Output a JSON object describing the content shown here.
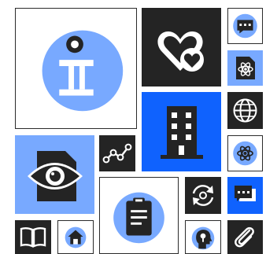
{
  "palette": {
    "dark": "#242424",
    "blue": "#0f62fe",
    "light_blue": "#78a9ff",
    "white": "#ffffff",
    "outline": "#2b2b2b"
  },
  "tiles": [
    {
      "icon": "information-icon",
      "background": "white"
    },
    {
      "icon": "favorite-hearts-icon",
      "background": "dark"
    },
    {
      "icon": "chat-bubble-icon",
      "background": "white"
    },
    {
      "icon": "atom-document-icon",
      "background": "light_blue"
    },
    {
      "icon": "building-icon",
      "background": "blue"
    },
    {
      "icon": "globe-icon",
      "background": "dark"
    },
    {
      "icon": "atom-icon",
      "background": "white"
    },
    {
      "icon": "visibility-document-icon",
      "background": "light_blue"
    },
    {
      "icon": "line-chart-icon",
      "background": "dark"
    },
    {
      "icon": "clipboard-icon",
      "background": "white"
    },
    {
      "icon": "refresh-circle-icon",
      "background": "dark"
    },
    {
      "icon": "chat-bubbles-icon",
      "background": "blue"
    },
    {
      "icon": "book-icon",
      "background": "dark"
    },
    {
      "icon": "home-icon",
      "background": "white"
    },
    {
      "icon": "head-profile-icon",
      "background": "white"
    },
    {
      "icon": "attachment-icon",
      "background": "dark"
    }
  ]
}
